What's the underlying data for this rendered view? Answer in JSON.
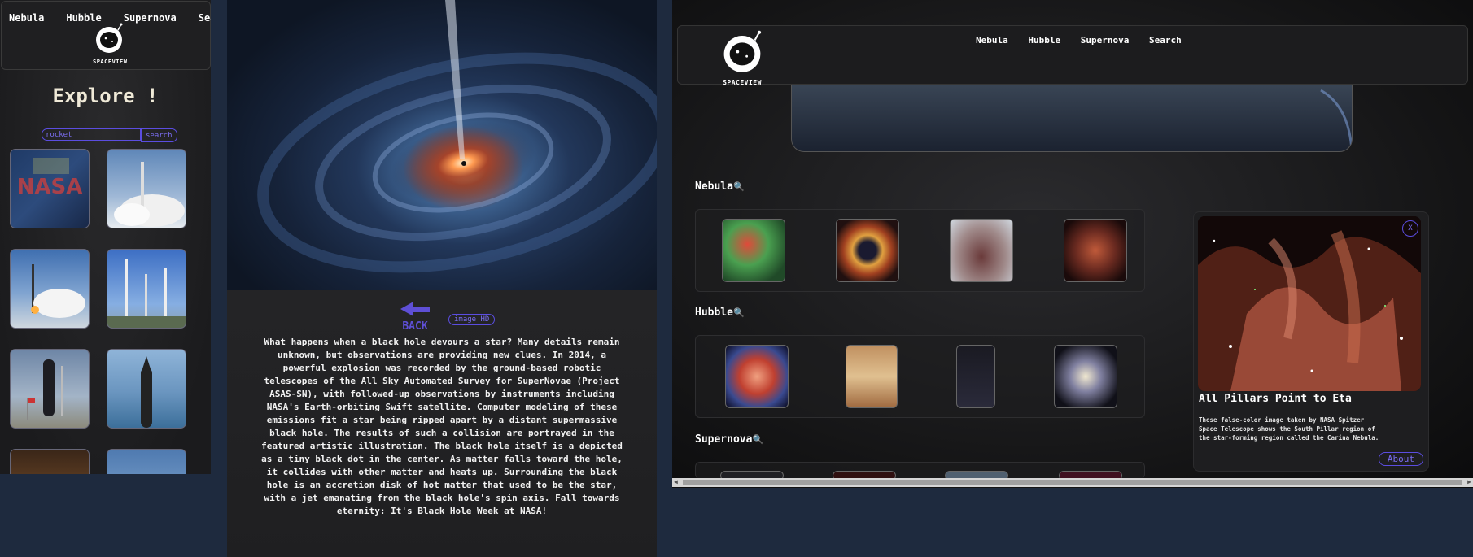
{
  "left": {
    "nav": [
      "Nebula",
      "Hubble",
      "Supernova",
      "Search"
    ],
    "logo_text": "SPACEVIEW",
    "heading": "Explore !",
    "search": {
      "value": "rocket",
      "button": "search"
    }
  },
  "middle": {
    "back_label": "BACK",
    "hd_button": "image HD",
    "description": "What happens when a black hole devours a star? Many details remain unknown, but observations are providing new clues. In 2014, a powerful explosion was recorded by the ground-based robotic telescopes of the All Sky Automated Survey for SuperNovae (Project ASAS-SN), with followed-up observations by instruments including NASA's Earth-orbiting Swift satellite. Computer modeling of these emissions fit a star being ripped apart by a distant supermassive black hole. The results of such a collision are portrayed in the featured artistic illustration. The black hole itself is a depicted as a tiny black dot in the center. As matter falls toward the hole, it collides with other matter and heats up. Surrounding the black hole is an accretion disk of hot matter that used to be the star, with a jet emanating from the black hole's spin axis. Fall towards eternity: It's Black Hole Week at NASA!"
  },
  "right": {
    "nav": [
      "Nebula",
      "Hubble",
      "Supernova",
      "Search"
    ],
    "logo_text": "SPACEVIEW",
    "sections": {
      "nebula": "Nebula",
      "hubble": "Hubble",
      "supernova": "Supernova"
    },
    "card": {
      "close": "X",
      "title": "All Pillars Point to Eta",
      "text": "These false-color image taken by NASA Spitzer Space Telescope shows the South Pillar region of the star-forming region called the Carina Nebula.",
      "about": "About"
    }
  },
  "colors": {
    "accent": "#5b4de0",
    "bg_outer": "#1e2a3e",
    "panel": "#1f1f21"
  }
}
